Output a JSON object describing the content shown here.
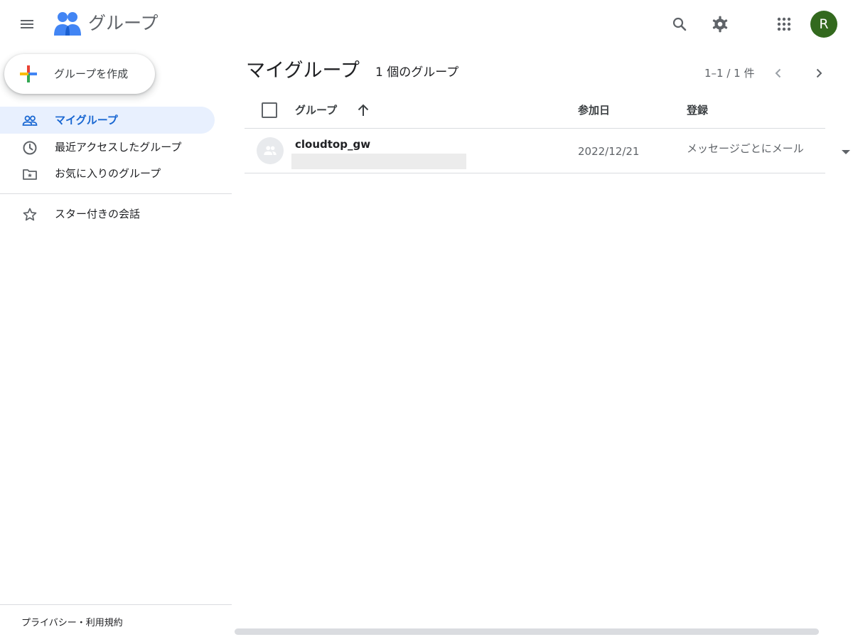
{
  "header": {
    "app_title": "グループ",
    "avatar_letter": "R",
    "colors": {
      "avatar_bg": "#33691e",
      "logo_blue": "#4285f4",
      "logo_dark": "#1a73e8"
    }
  },
  "sidebar": {
    "create_label": "グループを作成",
    "items": [
      {
        "label": "マイグループ",
        "icon": "people-icon",
        "active": true
      },
      {
        "label": "最近アクセスしたグループ",
        "icon": "clock-icon",
        "active": false
      },
      {
        "label": "お気に入りのグループ",
        "icon": "folder-star-icon",
        "active": false
      },
      {
        "label": "スター付きの会話",
        "icon": "star-icon",
        "active": false
      }
    ],
    "footer": "プライバシー・利用規約"
  },
  "main": {
    "title": "マイグループ",
    "count": "1 個のグループ",
    "pager": "1–1 / 1 件",
    "columns": {
      "group": "グループ",
      "joined": "参加日",
      "subscription": "登録"
    },
    "rows": [
      {
        "name": "cloudtop_gw",
        "date": "2022/12/21",
        "subscription": "メッセージごとにメール"
      }
    ]
  },
  "colors": {
    "active_bg": "#e8f0fe",
    "active_text": "#1967d2",
    "divider": "#dadce0"
  }
}
